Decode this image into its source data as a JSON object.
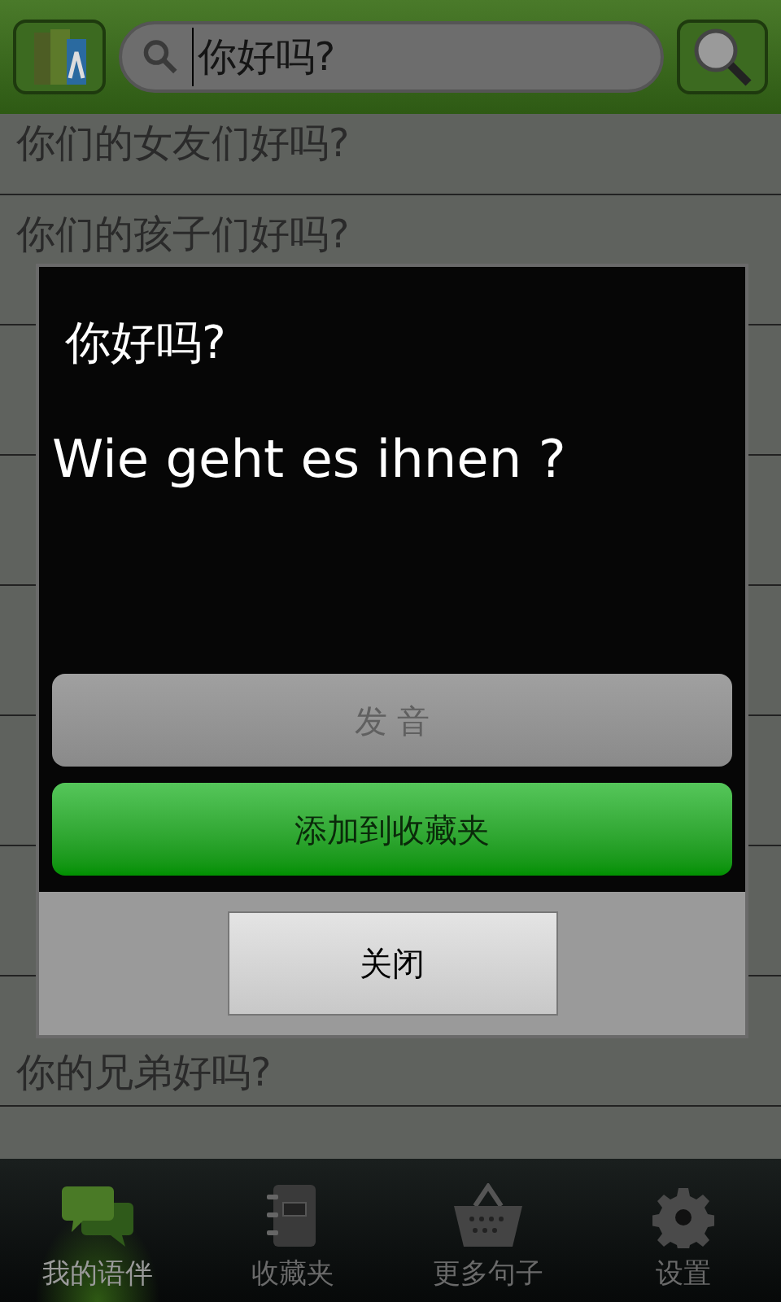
{
  "search": {
    "value": "你好吗?"
  },
  "list_top": [
    {
      "text": "你们的女友们好吗?"
    },
    {
      "text": "你们的孩子们好吗?"
    }
  ],
  "list_bottom": [
    {
      "text": "你的兄弟好吗?"
    }
  ],
  "dialog": {
    "title": "你好吗?",
    "translation": "Wie geht es ihnen ?",
    "buttons": [
      {
        "label": "发 音",
        "kind": "grey",
        "disabled": true
      },
      {
        "label": "添加到收藏夹",
        "kind": "green",
        "disabled": false
      }
    ],
    "close": "关闭"
  },
  "tabs": [
    {
      "label": "我的语伴",
      "selected": true
    },
    {
      "label": "收藏夹",
      "selected": false
    },
    {
      "label": "更多句子",
      "selected": false
    },
    {
      "label": "设置",
      "selected": false
    }
  ]
}
